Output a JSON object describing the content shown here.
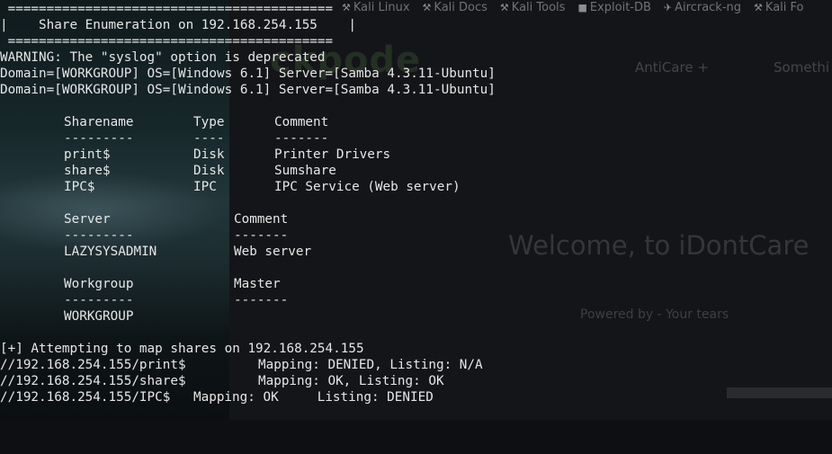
{
  "browser": {
    "bookmarks": [
      {
        "label": "Kali Linux",
        "icon": "kali-dragon-icon"
      },
      {
        "label": "Kali Docs",
        "icon": "kali-dragon-icon"
      },
      {
        "label": "Kali Tools",
        "icon": "kali-dragon-icon"
      },
      {
        "label": "Exploit-DB",
        "icon": "exploit-db-icon"
      },
      {
        "label": "Aircrack-ng",
        "icon": "aircrack-icon"
      },
      {
        "label": "Kali Fo",
        "icon": "kali-dragon-icon"
      }
    ],
    "site_logo": "ckpode",
    "nav_items": [
      "AntiCare +",
      "Somethi"
    ],
    "welcome": "Welcome, to iDontCare",
    "powered_by": "Powered by - Your tears"
  },
  "terminal": {
    "banner": {
      "rule_top": " ==========================================",
      "title": "|    Share Enumeration on 192.168.254.155    |",
      "rule_bottom": " =========================================="
    },
    "warning": "WARNING: The \"syslog\" option is deprecated",
    "domain_lines": [
      "Domain=[WORKGROUP] OS=[Windows 6.1] Server=[Samba 4.3.11-Ubuntu]",
      "Domain=[WORKGROUP] OS=[Windows 6.1] Server=[Samba 4.3.11-Ubuntu]"
    ],
    "shares_table": {
      "headers": [
        "Sharename",
        "Type",
        "Comment"
      ],
      "dividers": [
        "---------",
        "----",
        "-------"
      ],
      "rows": [
        [
          "print$",
          "Disk",
          "Printer Drivers"
        ],
        [
          "share$",
          "Disk",
          "Sumshare"
        ],
        [
          "IPC$",
          "IPC",
          "IPC Service (Web server)"
        ]
      ]
    },
    "server_table": {
      "headers": [
        "Server",
        "Comment"
      ],
      "dividers": [
        "---------",
        "-------"
      ],
      "rows": [
        [
          "LAZYSYSADMIN",
          "Web server"
        ]
      ]
    },
    "workgroup_table": {
      "headers": [
        "Workgroup",
        "Master"
      ],
      "dividers": [
        "---------",
        "-------"
      ],
      "rows": [
        [
          "WORKGROUP",
          ""
        ]
      ]
    },
    "mapping": {
      "intro": "[+] Attempting to map shares on 192.168.254.155",
      "results": [
        {
          "path": "//192.168.254.155/print$",
          "result": "Mapping: DENIED, Listing: N/A"
        },
        {
          "path": "//192.168.254.155/share$",
          "result": "Mapping: OK, Listing: OK"
        },
        {
          "path": "//192.168.254.155/IPC$",
          "result": "Mapping: OK     Listing: DENIED"
        }
      ]
    }
  }
}
